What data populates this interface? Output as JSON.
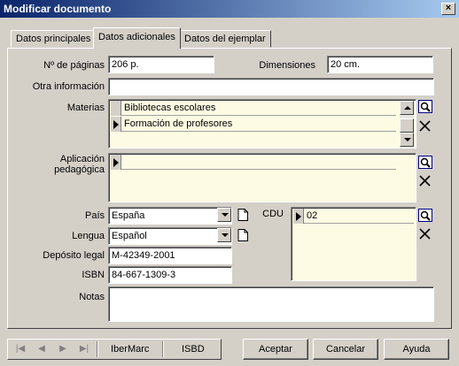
{
  "window": {
    "title": "Modificar documento",
    "close_label": "×"
  },
  "tabs": [
    {
      "label": "Datos principales",
      "active": false
    },
    {
      "label": "Datos adicionales",
      "active": true
    },
    {
      "label": "Datos del ejemplar",
      "active": false
    }
  ],
  "form": {
    "paginas": {
      "label": "Nº de páginas",
      "value": "206 p."
    },
    "dimensiones": {
      "label": "Dimensiones",
      "value": "20 cm."
    },
    "otra_info": {
      "label": "Otra información",
      "value": ""
    },
    "materias": {
      "label": "Materias",
      "items": [
        "Bibliotecas escolares",
        "Formación de profesores"
      ]
    },
    "aplicacion": {
      "label_line1": "Aplicación",
      "label_line2": "pedagógica",
      "items": [
        ""
      ]
    },
    "pais": {
      "label": "País",
      "value": "España"
    },
    "lengua": {
      "label": "Lengua",
      "value": "Español"
    },
    "deposito": {
      "label": "Depósito legal",
      "value": "M-42349-2001"
    },
    "isbn": {
      "label": "ISBN",
      "value": "84-667-1309-3"
    },
    "cdu": {
      "label": "CDU",
      "items": [
        "02"
      ]
    },
    "notas": {
      "label": "Notas",
      "value": ""
    }
  },
  "navigator": {
    "ibermarc": "IberMarc",
    "isbd": "ISBD"
  },
  "buttons": {
    "aceptar": "Aceptar",
    "cancelar": "Cancelar",
    "ayuda": "Ayuda"
  },
  "icons": {
    "search": "search-icon",
    "delete": "delete-icon",
    "new": "new-document-icon"
  },
  "colors": {
    "title_start": "#0a246a",
    "title_end": "#a6caf0",
    "face": "#d4d0c8",
    "grid_bg": "#fdfbe3"
  }
}
